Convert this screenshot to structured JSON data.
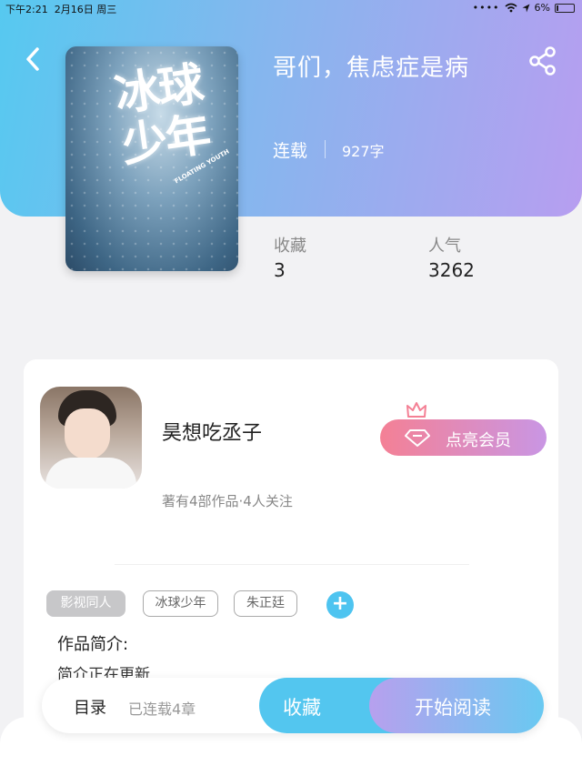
{
  "status_bar": {
    "time": "下午2:21",
    "date": "2月16日 周三",
    "battery": "6%"
  },
  "book": {
    "title": "哥们，焦虑症是病",
    "status": "连载",
    "word_count": "927字",
    "cover_art_title": "冰球少年",
    "cover_art_subtitle": "FLOATING YOUTH"
  },
  "stats": [
    {
      "label": "收藏",
      "value": "3"
    },
    {
      "label": "人气",
      "value": "3262"
    }
  ],
  "author": {
    "name": "昊想吃丞子",
    "meta": "著有4部作品·4人关注",
    "vip_button": "点亮会员"
  },
  "tags": [
    "影视同人",
    "冰球少年",
    "朱正廷"
  ],
  "intro": {
    "heading": "作品简介:",
    "text": "简介正在更新"
  },
  "bottom": {
    "toc": "目录",
    "chapters": "已连载4章",
    "collect": "收藏",
    "read": "开始阅读"
  },
  "colors": {
    "accent_blue": "#53c6ef",
    "accent_purple": "#b79ef0",
    "vip_pink": "#f48095"
  }
}
